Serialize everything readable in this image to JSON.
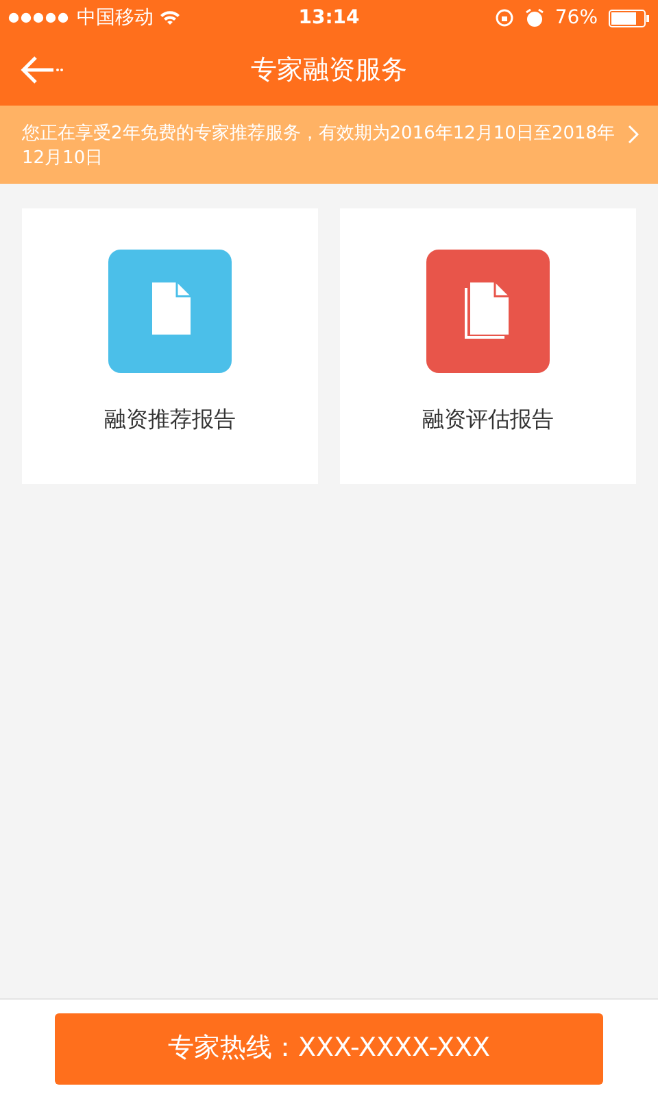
{
  "status_bar": {
    "carrier": "中国移动",
    "time": "13:14",
    "battery": "76%"
  },
  "nav": {
    "title": "专家融资服务"
  },
  "notice": {
    "text": "您正在享受2年免费的专家推荐服务，有效期为2016年12月10日至2018年12月10日"
  },
  "cards": [
    {
      "label": "融资推荐报告",
      "kind": "single",
      "color": "#4bbfe9"
    },
    {
      "label": "融资评估报告",
      "kind": "multi",
      "color": "#e8554a"
    }
  ],
  "hotline_button": {
    "label": "专家热线：XXX-XXXX-XXX"
  }
}
